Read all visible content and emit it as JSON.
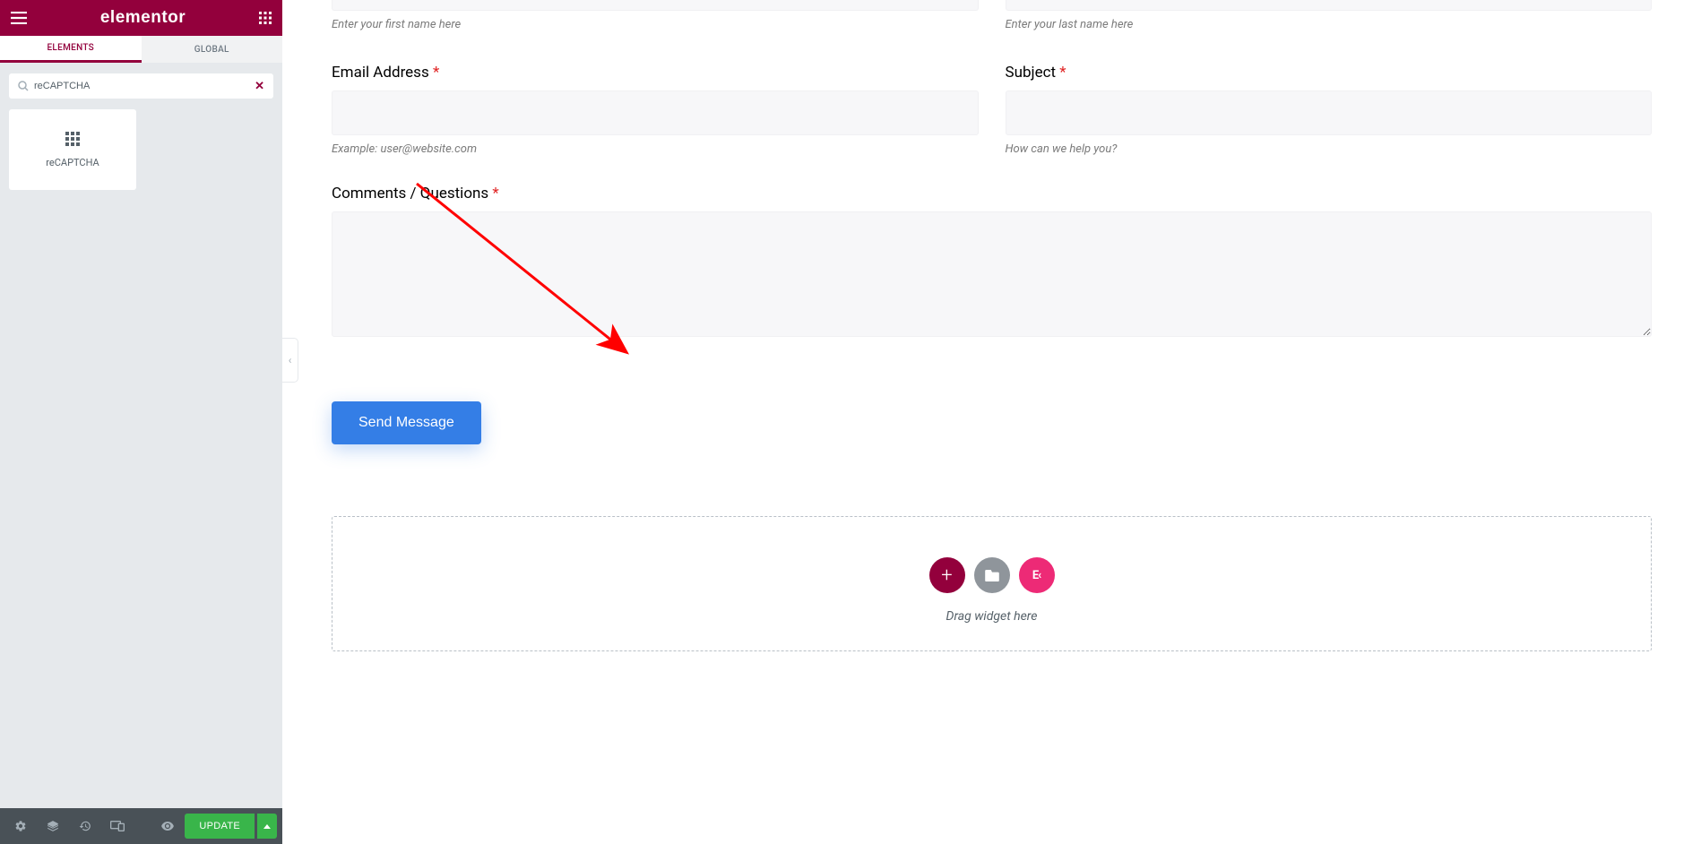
{
  "brand": "elementor",
  "tabs": {
    "elements": "ELEMENTS",
    "global": "GLOBAL"
  },
  "search": {
    "value": "reCAPTCHA",
    "clear": "✕"
  },
  "widget": {
    "label": "reCAPTCHA"
  },
  "bottombar": {
    "update": "UPDATE"
  },
  "form": {
    "firstName": {
      "hint": "Enter your first name here"
    },
    "lastName": {
      "hint": "Enter your last name here"
    },
    "email": {
      "label": "Email Address",
      "hint": "Example: user@website.com"
    },
    "subject": {
      "label": "Subject",
      "hint": "How can we help you?"
    },
    "comments": {
      "label": "Comments / Questions"
    },
    "submit": "Send Message",
    "required": "*"
  },
  "dropzone": {
    "template_glyph": "E‹",
    "hint": "Drag widget here"
  }
}
